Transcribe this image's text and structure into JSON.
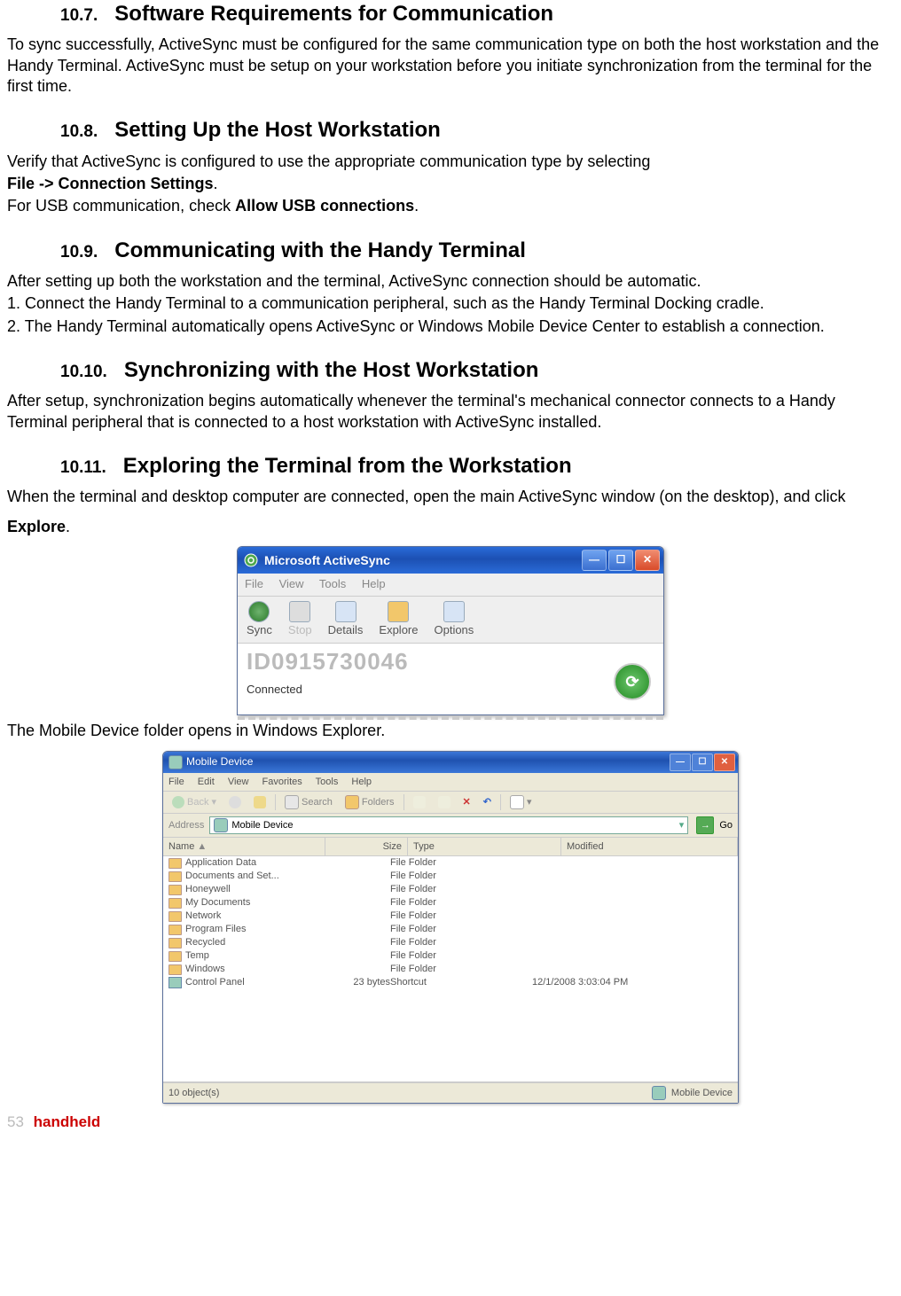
{
  "sections": {
    "s107": {
      "num": "10.7.",
      "title": "Software Requirements for Communication"
    },
    "s108": {
      "num": "10.8.",
      "title": "Setting Up the Host Workstation"
    },
    "s109": {
      "num": "10.9.",
      "title": "Communicating with the Handy Terminal"
    },
    "s1010": {
      "num": "10.10.",
      "title": "Synchronizing with the Host Workstation"
    },
    "s1011": {
      "num": "10.11.",
      "title": "Exploring the Terminal from the Workstation"
    }
  },
  "text": {
    "p107": "To sync successfully, ActiveSync must be configured for the same communication type on both the host workstation and the Handy Terminal. ActiveSync must be setup on your workstation before you initiate synchronization from the terminal for the first time.",
    "p108a": "Verify that ActiveSync is configured to use the appropriate communication type by selecting",
    "p108b_pre": "File -> Connection Settings",
    "p108b_post": ".",
    "p108c_pre": "For USB communication, check ",
    "p108c_bold": "Allow USB connections",
    "p108c_post": ".",
    "p109a": "After setting up both the workstation and the terminal, ActiveSync connection should be automatic.",
    "p109b": "1. Connect the Handy Terminal to a communication peripheral, such as the Handy Terminal Docking cradle.",
    "p109c": "2. The Handy Terminal automatically opens ActiveSync or Windows Mobile Device Center to establish a connection.",
    "p1010": "After setup, synchronization begins automatically whenever the terminal's mechanical connector connects to a Handy Terminal peripheral that is connected to a host workstation with ActiveSync installed.",
    "p1011a": "When the terminal and desktop computer are connected, open the main ActiveSync window (on the desktop), and click",
    "p1011a_bold": "Explore",
    "p1011a_post": ".",
    "p1011b": "The Mobile Device folder opens in Windows Explorer."
  },
  "activesync": {
    "title": "Microsoft ActiveSync",
    "menu": {
      "file": "File",
      "view": "View",
      "tools": "Tools",
      "help": "Help"
    },
    "toolbar": {
      "sync": "Sync",
      "stop": "Stop",
      "details": "Details",
      "explore": "Explore",
      "options": "Options"
    },
    "id": "ID0915730046",
    "status": "Connected"
  },
  "explorer": {
    "title": "Mobile Device",
    "menu": {
      "file": "File",
      "edit": "Edit",
      "view": "View",
      "favorites": "Favorites",
      "tools": "Tools",
      "help": "Help"
    },
    "toolbar": {
      "back": "Back",
      "search": "Search",
      "folders": "Folders"
    },
    "address_label": "Address",
    "address_value": "Mobile Device",
    "go_label": "Go",
    "headers": {
      "name": "Name",
      "size": "Size",
      "type": "Type",
      "modified": "Modified"
    },
    "rows": [
      {
        "name": "Application Data",
        "size": "",
        "type": "File Folder",
        "modified": ""
      },
      {
        "name": "Documents and Set...",
        "size": "",
        "type": "File Folder",
        "modified": ""
      },
      {
        "name": "Honeywell",
        "size": "",
        "type": "File Folder",
        "modified": ""
      },
      {
        "name": "My Documents",
        "size": "",
        "type": "File Folder",
        "modified": ""
      },
      {
        "name": "Network",
        "size": "",
        "type": "File Folder",
        "modified": ""
      },
      {
        "name": "Program Files",
        "size": "",
        "type": "File Folder",
        "modified": ""
      },
      {
        "name": "Recycled",
        "size": "",
        "type": "File Folder",
        "modified": ""
      },
      {
        "name": "Temp",
        "size": "",
        "type": "File Folder",
        "modified": ""
      },
      {
        "name": "Windows",
        "size": "",
        "type": "File Folder",
        "modified": ""
      },
      {
        "name": "Control Panel",
        "size": "23 bytes",
        "type": "Shortcut",
        "modified": "12/1/2008  3:03:04 PM"
      }
    ],
    "status_left": "10 object(s)",
    "status_right": "Mobile Device"
  },
  "footer": {
    "page": "53",
    "brand": "handheld"
  }
}
